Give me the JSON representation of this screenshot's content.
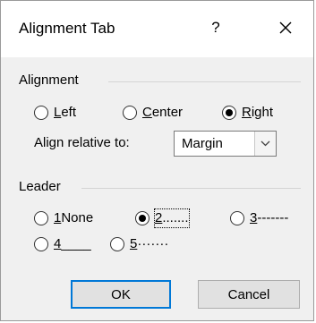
{
  "dialog": {
    "title": "Alignment Tab",
    "help_glyph": "?",
    "close_icon": "close-icon"
  },
  "alignment": {
    "group_label": "Alignment",
    "options": [
      {
        "mnemonic": "L",
        "rest": "eft",
        "checked": false
      },
      {
        "mnemonic": "C",
        "rest": "enter",
        "checked": false
      },
      {
        "mnemonic": "R",
        "rest": "ight",
        "checked": true
      }
    ],
    "relative_label": "Align relative to:",
    "relative_value": "Margin"
  },
  "leader": {
    "group_label": "Leader",
    "options": [
      {
        "mnemonic": "1",
        "rest": " None",
        "checked": false
      },
      {
        "mnemonic": "2",
        "rest": " .......",
        "checked": true
      },
      {
        "mnemonic": "3",
        "rest": " -------",
        "checked": false
      },
      {
        "mnemonic": "4",
        "rest": " ____",
        "checked": false
      },
      {
        "mnemonic": "5",
        "rest": " ·······",
        "checked": false
      }
    ]
  },
  "buttons": {
    "ok": "OK",
    "cancel": "Cancel"
  },
  "colors": {
    "dialog_bg": "#f0f0f0",
    "title_bg": "#ffffff",
    "accent": "#0078d7"
  }
}
